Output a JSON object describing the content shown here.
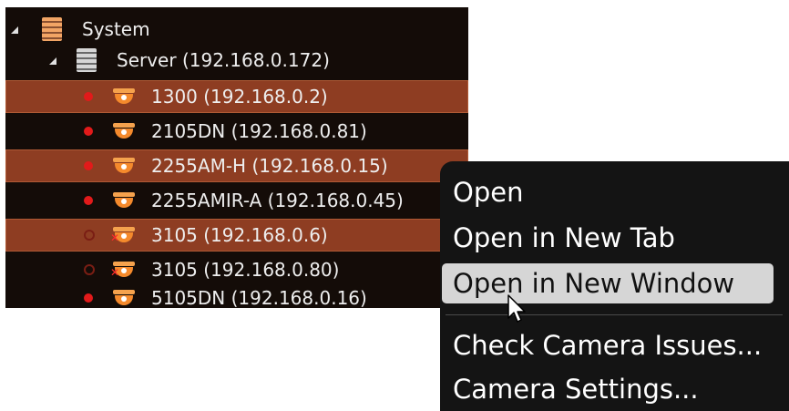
{
  "tree": {
    "root": {
      "label": "System",
      "icon": "system-server-stack-icon",
      "expanded": true
    },
    "server": {
      "label": "Server (192.168.0.172)",
      "icon": "server-stack-icon",
      "expanded": true
    },
    "cameras": [
      {
        "label": "1300 (192.168.0.2)",
        "selected": true,
        "status": "active",
        "icon": "dome-camera-icon"
      },
      {
        "label": "2105DN (192.168.0.81)",
        "selected": false,
        "status": "active",
        "icon": "dome-camera-icon"
      },
      {
        "label": "2255AM-H (192.168.0.15)",
        "selected": true,
        "status": "active",
        "icon": "dome-camera-icon"
      },
      {
        "label": "2255AMIR-A (192.168.0.45)",
        "selected": false,
        "status": "active",
        "icon": "dome-camera-icon"
      },
      {
        "label": "3105 (192.168.0.6)",
        "selected": true,
        "status": "offline",
        "icon": "dome-camera-error-icon"
      },
      {
        "label": "3105 (192.168.0.80)",
        "selected": false,
        "status": "offline",
        "icon": "dome-camera-error-icon"
      },
      {
        "label": "5105DN (192.168.0.16)",
        "selected": false,
        "status": "active",
        "icon": "dome-camera-icon"
      }
    ]
  },
  "context_menu": {
    "items": [
      {
        "label": "Open"
      },
      {
        "label": "Open in New Tab"
      },
      {
        "label": "Open in New Window",
        "hovered": true
      },
      {
        "label": "Check Camera Issues..."
      },
      {
        "label": "Camera Settings..."
      }
    ]
  },
  "colors": {
    "tree_background": "#140c08",
    "selected_row": "#8e3d22",
    "menu_background": "#141414",
    "menu_hover": "#d6d6d6",
    "status_red": "#e21a1a",
    "camera_orange": "#f58a2c"
  }
}
